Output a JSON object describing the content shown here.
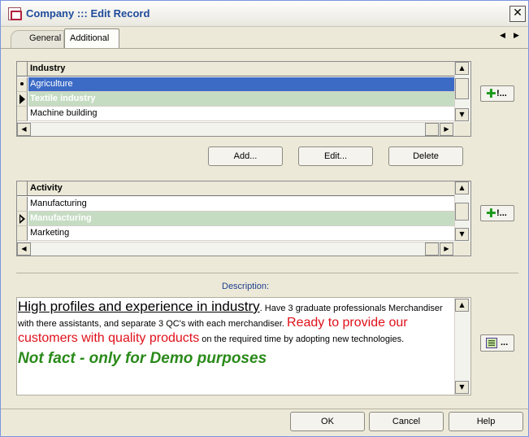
{
  "window": {
    "title": "Company ::: Edit Record",
    "close_glyph": "✕"
  },
  "tabs": [
    {
      "label": "General",
      "active": false
    },
    {
      "label": "Additional",
      "active": true
    }
  ],
  "tab_nav": {
    "prev": "◀",
    "next": "▶"
  },
  "industry_grid": {
    "header": "Industry",
    "rows": [
      "Agriculture",
      "Textile industry",
      "Machine building"
    ]
  },
  "activity_grid": {
    "header": "Activity",
    "rows": [
      "Manufacturing",
      "Manufacturing",
      "Marketing"
    ]
  },
  "lookup_button": {
    "plus": "✚",
    "mark": "!..."
  },
  "actions": {
    "add": "Add...",
    "edit": "Edit...",
    "delete": "Delete"
  },
  "description": {
    "label": "Description:",
    "part1": "High profiles and experience in industry",
    "part2": ". Have 3 graduate professionals Merchandiser with there assistants, and separate 3 QC's with each merchandiser. ",
    "part3": "Ready to provide our customers with quality products",
    "part4": " on the required time by adopting new technologies.",
    "part5": "Not fact - only for Demo purposes",
    "editor_mark": "..."
  },
  "footer": {
    "ok": "OK",
    "cancel": "Cancel",
    "help": "Help"
  },
  "colors": {
    "selected_row": "#3c6bc6",
    "current_row": "#c5dcc3",
    "title_text": "#1f4b9b",
    "accent_red": "#e0101a",
    "accent_green": "#2a8a1a"
  }
}
